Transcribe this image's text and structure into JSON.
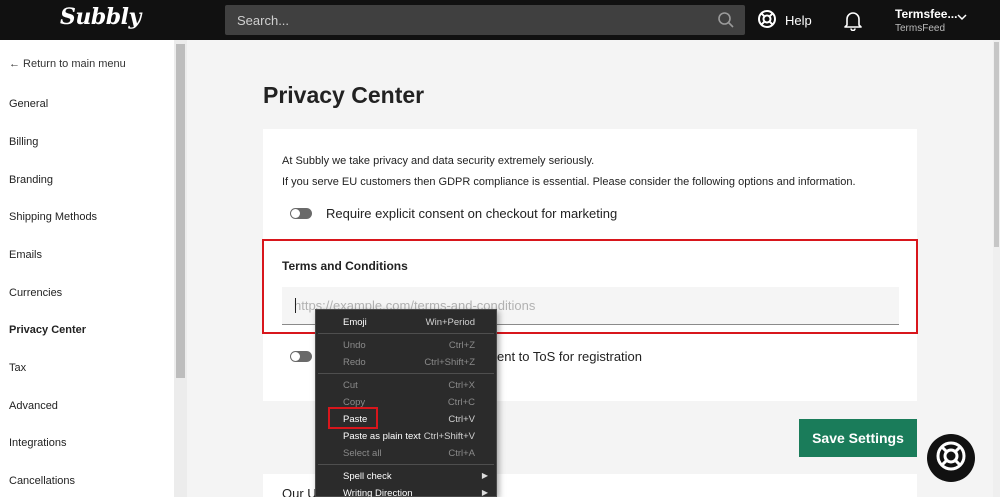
{
  "topbar": {
    "logo": "Subbly",
    "search_placeholder": "Search...",
    "help_label": "Help",
    "account_name": "Termsfee...",
    "account_sub": "TermsFeed"
  },
  "sidebar": {
    "return_label": "← Return to main menu",
    "items": [
      {
        "label": "General"
      },
      {
        "label": "Billing"
      },
      {
        "label": "Branding"
      },
      {
        "label": "Shipping Methods"
      },
      {
        "label": "Emails"
      },
      {
        "label": "Currencies"
      },
      {
        "label": "Privacy Center",
        "active": true
      },
      {
        "label": "Tax"
      },
      {
        "label": "Advanced"
      },
      {
        "label": "Integrations"
      },
      {
        "label": "Cancellations"
      }
    ]
  },
  "main": {
    "title": "Privacy Center",
    "intro_line1": "At Subbly we take privacy and data security extremely seriously.",
    "intro_line2": "If you serve EU customers then GDPR compliance is essential. Please consider the following options and information.",
    "toggle1_label": "Require explicit consent on checkout for marketing",
    "terms_title": "Terms and Conditions",
    "terms_placeholder": "https://example.com/terms-and-conditions",
    "toggle2_label_visible": "ent to ToS for registration",
    "save_label": "Save Settings",
    "card2_text": "Our U"
  },
  "context_menu": {
    "items": [
      {
        "label": "Emoji",
        "shortcut": "Win+Period",
        "disabled": false
      },
      {
        "label": "Undo",
        "shortcut": "Ctrl+Z",
        "disabled": true
      },
      {
        "label": "Redo",
        "shortcut": "Ctrl+Shift+Z",
        "disabled": true
      },
      {
        "label": "Cut",
        "shortcut": "Ctrl+X",
        "disabled": true
      },
      {
        "label": "Copy",
        "shortcut": "Ctrl+C",
        "disabled": true
      },
      {
        "label": "Paste",
        "shortcut": "Ctrl+V",
        "disabled": false
      },
      {
        "label": "Paste as plain text",
        "shortcut": "Ctrl+Shift+V",
        "disabled": false
      },
      {
        "label": "Select all",
        "shortcut": "Ctrl+A",
        "disabled": true
      },
      {
        "label": "Spell check",
        "shortcut": "",
        "disabled": false,
        "submenu": true
      },
      {
        "label": "Writing Direction",
        "shortcut": "",
        "disabled": false,
        "submenu": true
      }
    ]
  },
  "colors": {
    "topbar": "#111111",
    "accent_green": "#1a7c5a",
    "highlight_red": "#d8161c",
    "menu_bg": "#2b2b2b"
  },
  "icons": {
    "search": "search-icon",
    "help": "lifebuoy-icon",
    "notifications": "bell-icon",
    "account_menu": "chevron-down-icon",
    "support": "lifebuoy-icon",
    "submenu": "triangle-right-icon"
  }
}
